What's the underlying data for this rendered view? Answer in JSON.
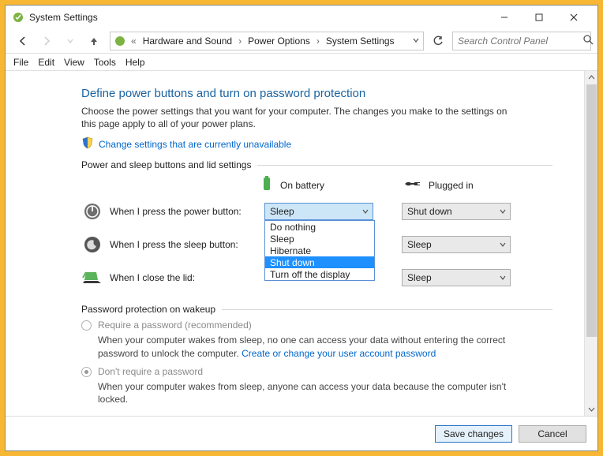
{
  "title": "System Settings",
  "breadcrumb": {
    "prefix": "«",
    "items": [
      "Hardware and Sound",
      "Power Options",
      "System Settings"
    ]
  },
  "search": {
    "placeholder": "Search Control Panel"
  },
  "menu": [
    "File",
    "Edit",
    "View",
    "Tools",
    "Help"
  ],
  "heading": "Define power buttons and turn on password protection",
  "intro": "Choose the power settings that you want for your computer. The changes you make to the settings on this page apply to all of your power plans.",
  "change_link": "Change settings that are currently unavailable",
  "section1": {
    "title": "Power and sleep buttons and lid settings",
    "col1": "On battery",
    "col2": "Plugged in",
    "rows": [
      {
        "label": "When I press the power button:",
        "battery": "Sleep",
        "plugged": "Shut down"
      },
      {
        "label": "When I press the sleep button:",
        "battery": "",
        "plugged": "Sleep"
      },
      {
        "label": "When I close the lid:",
        "battery": "",
        "plugged": "Sleep"
      }
    ],
    "dropdown_options": [
      "Do nothing",
      "Sleep",
      "Hibernate",
      "Shut down",
      "Turn off the display"
    ],
    "dropdown_selected": "Shut down"
  },
  "section2": {
    "title": "Password protection on wakeup",
    "opt1": {
      "label": "Require a password (recommended)",
      "desc_a": "When your computer wakes from sleep, no one can access your data without entering the correct password to unlock the computer. ",
      "link": "Create or change your user account password"
    },
    "opt2": {
      "label": "Don't require a password",
      "desc": "When your computer wakes from sleep, anyone can access your data because the computer isn't locked."
    }
  },
  "buttons": {
    "save": "Save changes",
    "cancel": "Cancel"
  }
}
